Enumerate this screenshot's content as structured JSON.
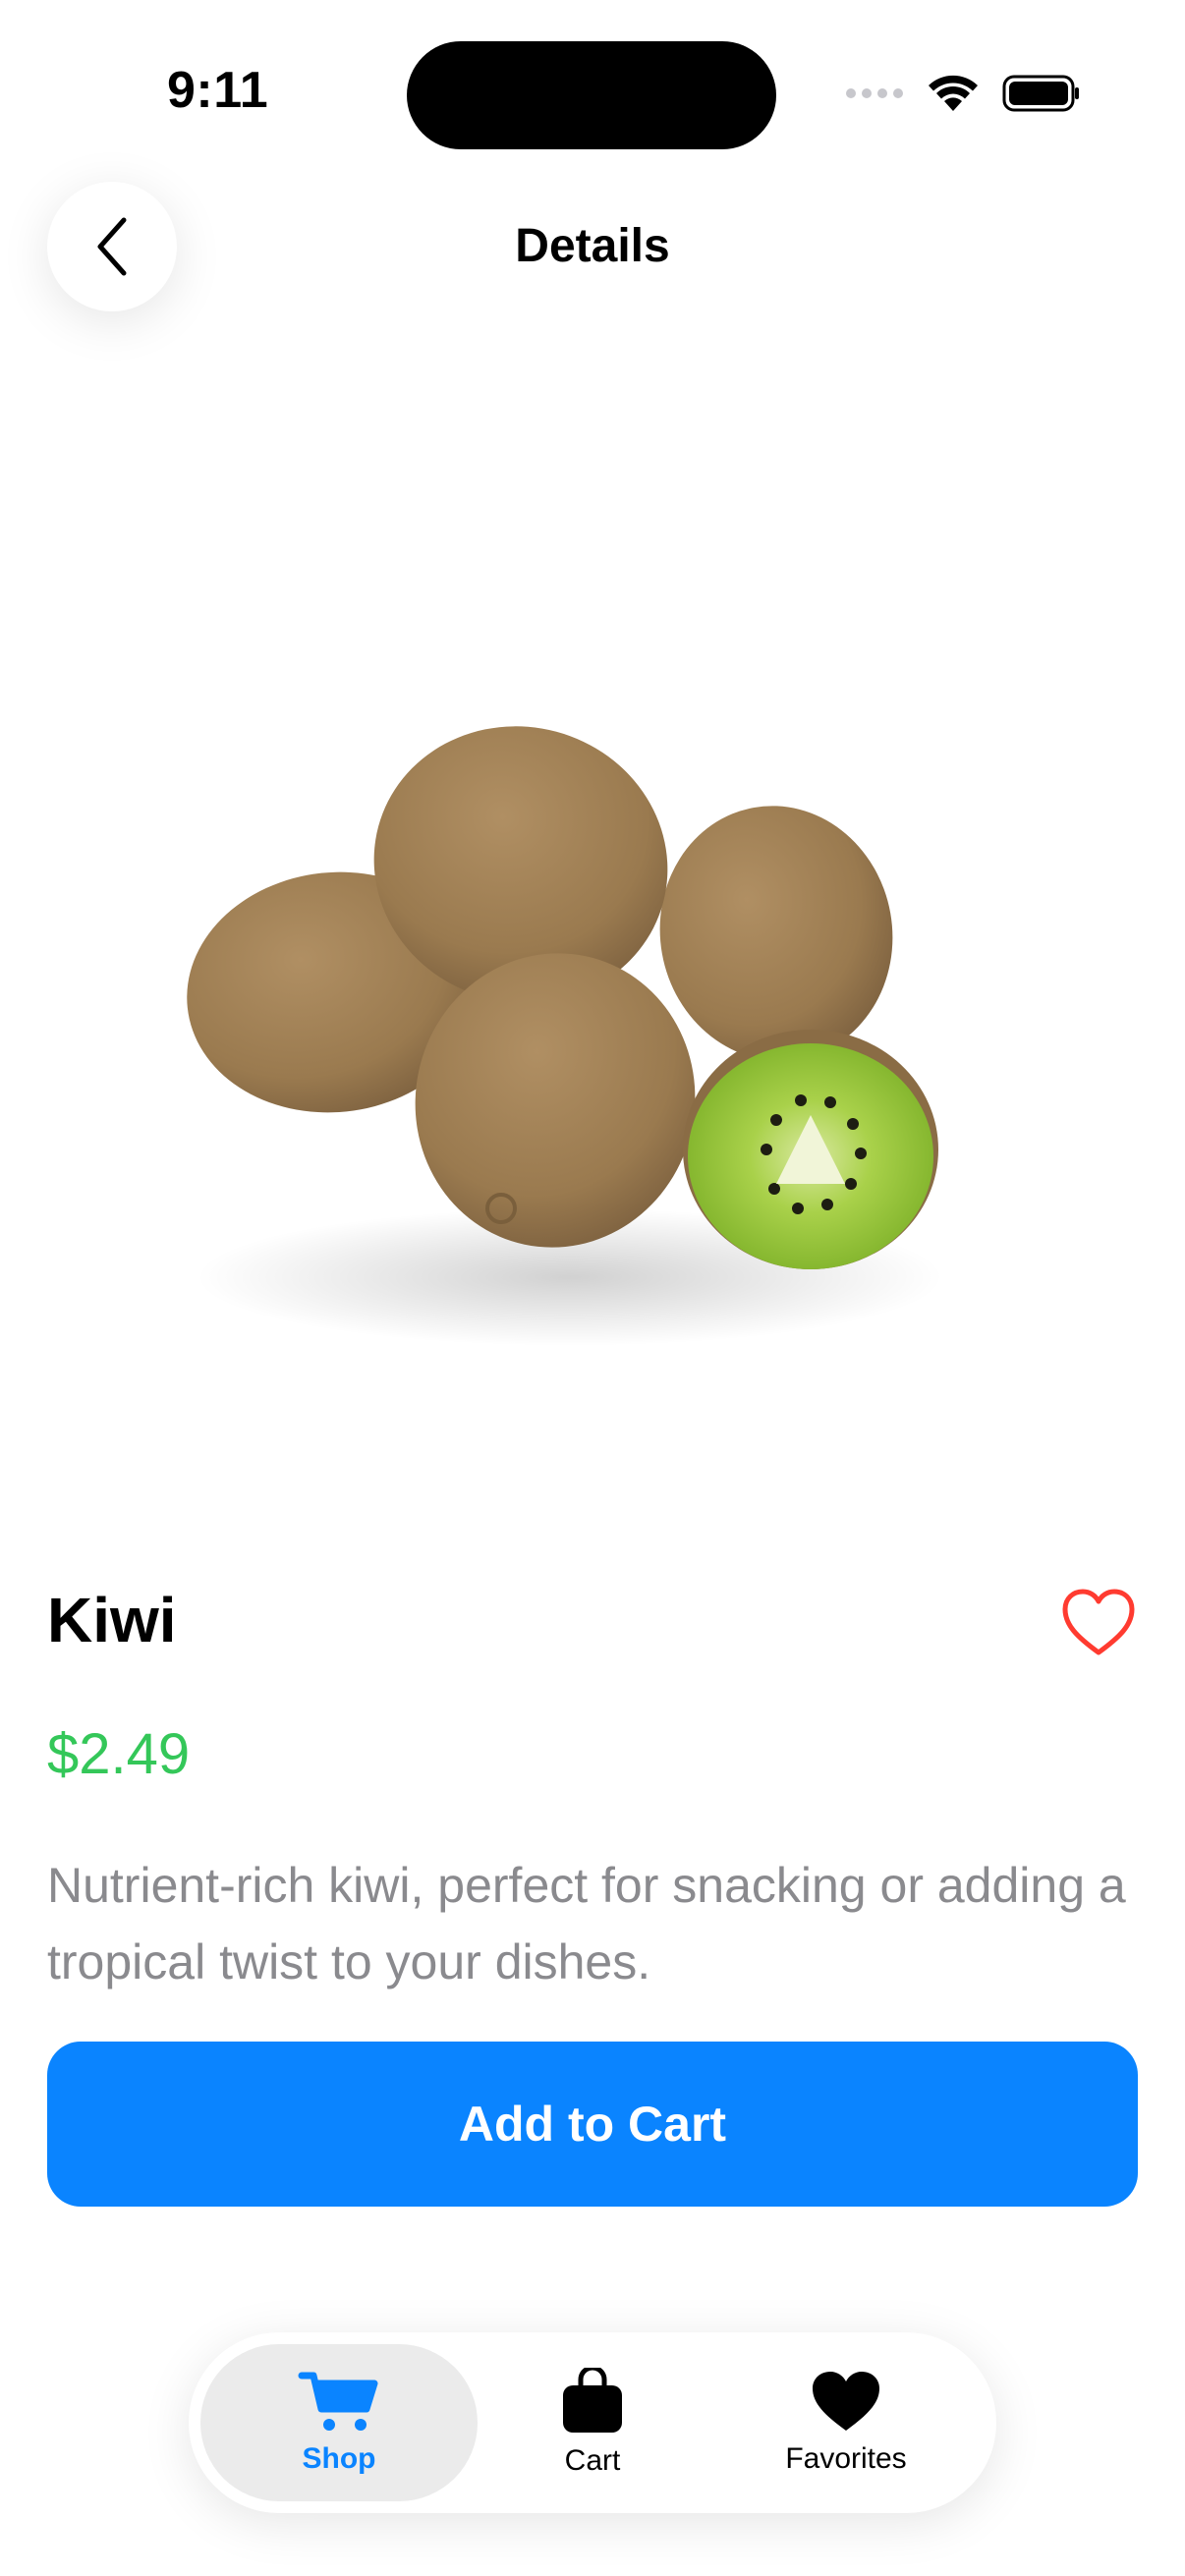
{
  "status_bar": {
    "time": "9:11"
  },
  "header": {
    "title": "Details",
    "back_icon": "chevron-left-icon"
  },
  "product": {
    "name": "Kiwi",
    "price": "$2.49",
    "description": "Nutrient-rich kiwi, perfect for snacking or adding a tropical twist to your dishes.",
    "favorite_icon": "heart-outline-icon",
    "image_icon": "kiwi-fruit-image"
  },
  "actions": {
    "add_to_cart_label": "Add to Cart"
  },
  "tab_bar": {
    "selected": "Shop",
    "items": [
      {
        "label": "Shop",
        "icon": "cart-icon"
      },
      {
        "label": "Cart",
        "icon": "bag-icon"
      },
      {
        "label": "Favorites",
        "icon": "heart-icon"
      }
    ]
  },
  "colors": {
    "accent": "#0a84ff",
    "price": "#34c759",
    "favorite": "#ff3b30",
    "description": "#8a8a8e"
  }
}
